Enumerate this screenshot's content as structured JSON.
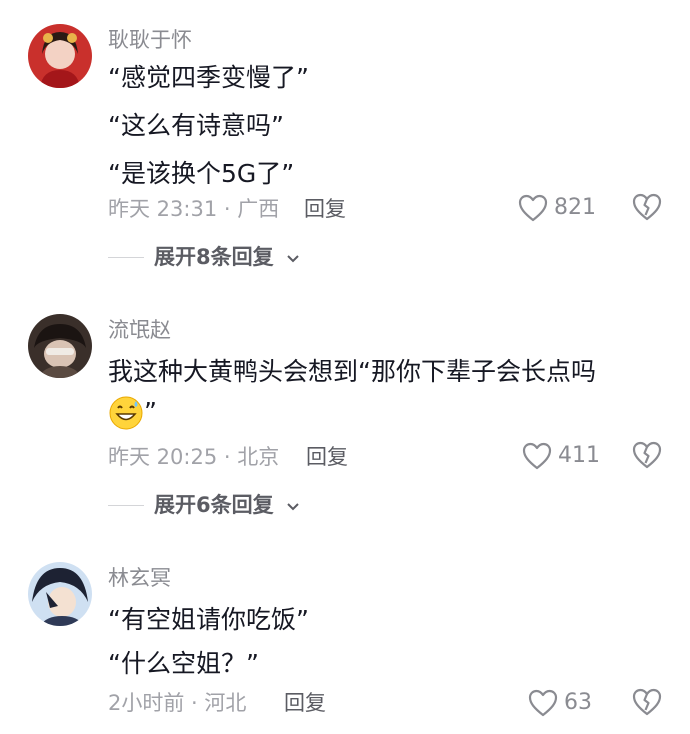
{
  "comments": [
    {
      "username": "耿耿于怀",
      "lines": [
        "“感觉四季变慢了”",
        "“这么有诗意吗”",
        "“是该换个5G了”"
      ],
      "time_location": "昨天 23:31 · 广西",
      "reply_label": "回复",
      "likes": "821",
      "expand_label": "展开8条回复"
    },
    {
      "username": "流氓赵",
      "lines": [
        "我这种大黄鸭头会想到“那你下辈子会长点吗",
        "”"
      ],
      "time_location": "昨天 20:25 · 北京",
      "reply_label": "回复",
      "likes": "411",
      "expand_label": "展开6条回复"
    },
    {
      "username": "林玄冥",
      "lines": [
        "“有空姐请你吃饭”",
        "“什么空姐？”"
      ],
      "time_location": "2小时前 · 河北",
      "reply_label": "回复",
      "likes": "63"
    }
  ],
  "icons": {
    "like": "heart-outline-icon",
    "dislike": "broken-heart-icon",
    "expand": "chevron-down-icon",
    "emoji": "grinning-sweat-emoji"
  }
}
